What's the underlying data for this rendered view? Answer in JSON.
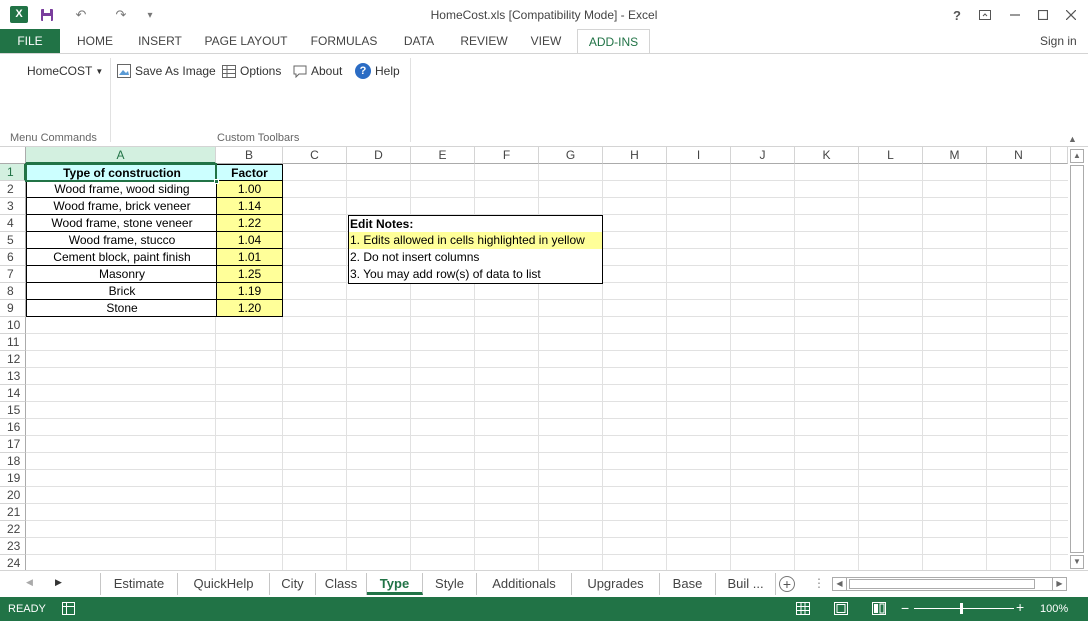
{
  "window": {
    "title": "HomeCost.xls  [Compatibility Mode] - Excel",
    "help": "?",
    "undo": "↶",
    "redo": "↷",
    "customize": "▾"
  },
  "ribbon_tabs": [
    "FILE",
    "HOME",
    "INSERT",
    "PAGE LAYOUT",
    "FORMULAS",
    "DATA",
    "REVIEW",
    "VIEW",
    "ADD-INS"
  ],
  "sign_in": "Sign in",
  "ribbon": {
    "homecost_label": "HomeCOST",
    "save_as_image": "Save As Image",
    "options": "Options",
    "about": "About",
    "help": "Help",
    "group_menu": "Menu Commands",
    "group_toolbars": "Custom Toolbars"
  },
  "columns": [
    "A",
    "B",
    "C",
    "D",
    "E",
    "F",
    "G",
    "H",
    "I",
    "J",
    "K",
    "L",
    "M",
    "N"
  ],
  "rows": [
    "1",
    "2",
    "3",
    "4",
    "5",
    "6",
    "7",
    "8",
    "9",
    "10",
    "11",
    "12",
    "13",
    "14",
    "15",
    "16",
    "17",
    "18",
    "19",
    "20",
    "21",
    "22",
    "23",
    "24"
  ],
  "table": {
    "header_a": "Type of construction",
    "header_b": "Factor",
    "items": [
      {
        "type": "Wood frame, wood siding",
        "factor": "1.00"
      },
      {
        "type": "Wood frame, brick veneer",
        "factor": "1.14"
      },
      {
        "type": "Wood frame, stone veneer",
        "factor": "1.22"
      },
      {
        "type": "Wood frame, stucco",
        "factor": "1.04"
      },
      {
        "type": "Cement block, paint finish",
        "factor": "1.01"
      },
      {
        "type": "Masonry",
        "factor": "1.25"
      },
      {
        "type": "Brick",
        "factor": "1.19"
      },
      {
        "type": "Stone",
        "factor": "1.20"
      }
    ]
  },
  "notes": {
    "title": "Edit Notes:",
    "line1": "1. Edits allowed in cells highlighted in yellow",
    "line2": "2. Do not insert columns",
    "line3": "3. You may add row(s) of data to list"
  },
  "sheet_tabs": [
    "Estimate",
    "QuickHelp",
    "City",
    "Class",
    "Type",
    "Style",
    "Additionals",
    "Upgrades",
    "Base",
    "Buil ..."
  ],
  "active_sheet": "Type",
  "status": {
    "ready": "READY",
    "zoom": "100%"
  },
  "colors": {
    "excel_green": "#217346",
    "header_fill": "#ccffff",
    "edit_yellow": "#ffff99"
  }
}
